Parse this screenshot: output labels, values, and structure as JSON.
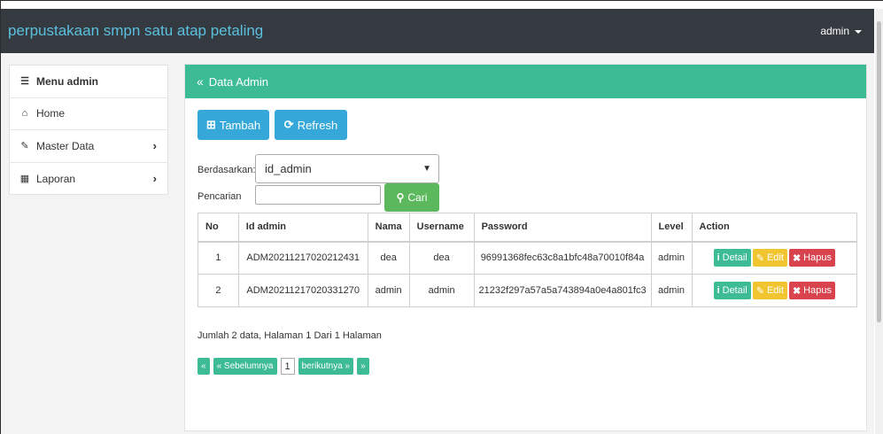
{
  "navbar": {
    "brand": "perpustakaan smpn satu atap petaling",
    "user_menu": "admin"
  },
  "sidebar": {
    "header": "Menu admin",
    "items": [
      {
        "label": "Home",
        "icon": "home-icon"
      },
      {
        "label": "Master Data",
        "icon": "edit-icon"
      },
      {
        "label": "Laporan",
        "icon": "calendar-icon"
      }
    ]
  },
  "panel": {
    "title": "Data Admin",
    "tambah_label": "Tambah",
    "refresh_label": "Refresh",
    "filter_label": "Berdasarkan:",
    "filter_value": "id_admin",
    "search_label": "Pencarian",
    "search_value": "",
    "cari_label": "Cari"
  },
  "table": {
    "headers": [
      "No",
      "Id admin",
      "Nama",
      "Username",
      "Password",
      "Level",
      "Action"
    ],
    "rows": [
      {
        "no": "1",
        "id": "ADM20211217020212431",
        "nama": "dea",
        "username": "dea",
        "password": "96991368fec63c8a1bfc48a70010f84a",
        "level": "admin"
      },
      {
        "no": "2",
        "id": "ADM20211217020331270",
        "nama": "admin",
        "username": "admin",
        "password": "21232f297a57a5a743894a0e4a801fc3",
        "level": "admin"
      }
    ],
    "action_labels": {
      "detail": "Detail",
      "edit": "Edit",
      "hapus": "Hapus"
    }
  },
  "summary": "Jumlah 2 data, Halaman 1 Dari 1 Halaman",
  "pagination": {
    "first": "«",
    "prev": "« Sebelumnya",
    "current": "1",
    "next": "berikutnya »",
    "last": "»"
  },
  "colors": {
    "navbar": "#343a40",
    "brand": "#5bc0de",
    "accent": "#3cbb95",
    "info": "#35a8d9",
    "success": "#5cb85c",
    "warning": "#f0c530",
    "danger": "#d9434e"
  }
}
